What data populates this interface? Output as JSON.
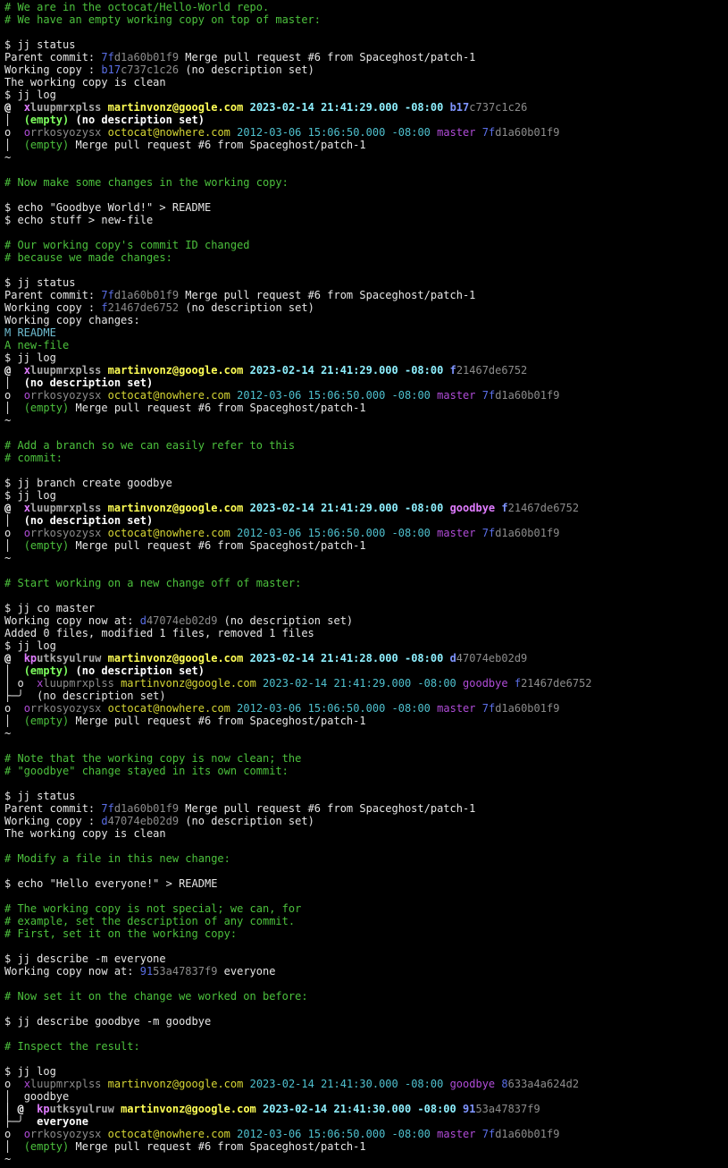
{
  "colors": {
    "background": "#000000",
    "text": "#e6e6e6",
    "comment": "#4cc13d",
    "change_id_prefix": "#b04cd8",
    "commit_id_prefix": "#5b6fe8",
    "email": "#d7d735",
    "timestamp": "#4fc1cf",
    "branch": "#b04cd8",
    "modified": "#6fbcd0",
    "added": "#4cc13d"
  },
  "lines": [
    [
      {
        "t": "# We are in the octocat/Hello-World repo.",
        "c": "comment"
      }
    ],
    [
      {
        "t": "# We have an empty working copy on top of master:",
        "c": "comment"
      }
    ],
    [],
    [
      {
        "t": "$ jj status",
        "c": "cmd"
      }
    ],
    [
      {
        "t": "Parent commit: ",
        "c": "plain"
      },
      {
        "t": "7f",
        "c": "c-blue"
      },
      {
        "t": "d1a60b01f9",
        "c": "c-gray"
      },
      {
        "t": " Merge pull request #6 from Spaceghost/patch-1",
        "c": "plain"
      }
    ],
    [
      {
        "t": "Working copy : ",
        "c": "plain"
      },
      {
        "t": "b17",
        "c": "c-blue"
      },
      {
        "t": "c737c1c26",
        "c": "c-gray"
      },
      {
        "t": " (no description set)",
        "c": "plain"
      }
    ],
    [
      {
        "t": "The working copy is clean",
        "c": "plain"
      }
    ],
    [
      {
        "t": "$ jj log",
        "c": "cmd"
      }
    ],
    [
      {
        "t": "@  ",
        "c": "c-bold"
      },
      {
        "t": "x",
        "c": "c-bpurple"
      },
      {
        "t": "luupmrxplss",
        "c": "c-bgray"
      },
      {
        "t": " ",
        "c": "plain"
      },
      {
        "t": "martinvonz@google.com",
        "c": "c-byellow"
      },
      {
        "t": " ",
        "c": "plain"
      },
      {
        "t": "2023-02-14 21:41:29.000 -08:00",
        "c": "c-bcyan"
      },
      {
        "t": " ",
        "c": "plain"
      },
      {
        "t": "b17",
        "c": "c-bblue"
      },
      {
        "t": "c737c1c26",
        "c": "c-gray"
      }
    ],
    [
      {
        "t": "│  ",
        "c": "c-white"
      },
      {
        "t": "(empty)",
        "c": "c-bgreen"
      },
      {
        "t": " (no description set)",
        "c": "c-bold"
      }
    ],
    [
      {
        "t": "o  ",
        "c": "c-white"
      },
      {
        "t": "o",
        "c": "c-purple"
      },
      {
        "t": "rrkosyozysx",
        "c": "c-gray"
      },
      {
        "t": " ",
        "c": "plain"
      },
      {
        "t": "octocat@nowhere.com",
        "c": "c-yellow"
      },
      {
        "t": " ",
        "c": "plain"
      },
      {
        "t": "2012-03-06 15:06:50.000 -08:00",
        "c": "c-cyan"
      },
      {
        "t": " ",
        "c": "plain"
      },
      {
        "t": "master",
        "c": "c-purple"
      },
      {
        "t": " ",
        "c": "plain"
      },
      {
        "t": "7f",
        "c": "c-blue"
      },
      {
        "t": "d1a60b01f9",
        "c": "c-gray"
      }
    ],
    [
      {
        "t": "│  ",
        "c": "c-white"
      },
      {
        "t": "(empty)",
        "c": "c-green"
      },
      {
        "t": " Merge pull request #6 from Spaceghost/patch-1",
        "c": "plain"
      }
    ],
    [
      {
        "t": "~",
        "c": "c-white"
      }
    ],
    [],
    [
      {
        "t": "# Now make some changes in the working copy:",
        "c": "comment"
      }
    ],
    [],
    [
      {
        "t": "$ echo \"Goodbye World!\" > README",
        "c": "cmd"
      }
    ],
    [
      {
        "t": "$ echo stuff > new-file",
        "c": "cmd"
      }
    ],
    [],
    [
      {
        "t": "# Our working copy's commit ID changed",
        "c": "comment"
      }
    ],
    [
      {
        "t": "# because we made changes:",
        "c": "comment"
      }
    ],
    [],
    [
      {
        "t": "$ jj status",
        "c": "cmd"
      }
    ],
    [
      {
        "t": "Parent commit: ",
        "c": "plain"
      },
      {
        "t": "7f",
        "c": "c-blue"
      },
      {
        "t": "d1a60b01f9",
        "c": "c-gray"
      },
      {
        "t": " Merge pull request #6 from Spaceghost/patch-1",
        "c": "plain"
      }
    ],
    [
      {
        "t": "Working copy : ",
        "c": "plain"
      },
      {
        "t": "f",
        "c": "c-blue"
      },
      {
        "t": "21467de6752",
        "c": "c-gray"
      },
      {
        "t": " (no description set)",
        "c": "plain"
      }
    ],
    [
      {
        "t": "Working copy changes:",
        "c": "plain"
      }
    ],
    [
      {
        "t": "M README",
        "c": "mod"
      }
    ],
    [
      {
        "t": "A new-file",
        "c": "add"
      }
    ],
    [
      {
        "t": "$ jj log",
        "c": "cmd"
      }
    ],
    [
      {
        "t": "@  ",
        "c": "c-bold"
      },
      {
        "t": "x",
        "c": "c-bpurple"
      },
      {
        "t": "luupmrxplss",
        "c": "c-bgray"
      },
      {
        "t": " ",
        "c": "plain"
      },
      {
        "t": "martinvonz@google.com",
        "c": "c-byellow"
      },
      {
        "t": " ",
        "c": "plain"
      },
      {
        "t": "2023-02-14 21:41:29.000 -08:00",
        "c": "c-bcyan"
      },
      {
        "t": " ",
        "c": "plain"
      },
      {
        "t": "f",
        "c": "c-bblue"
      },
      {
        "t": "21467de6752",
        "c": "c-gray"
      }
    ],
    [
      {
        "t": "│  ",
        "c": "c-white"
      },
      {
        "t": "(no description set)",
        "c": "c-bold"
      }
    ],
    [
      {
        "t": "o  ",
        "c": "c-white"
      },
      {
        "t": "o",
        "c": "c-purple"
      },
      {
        "t": "rrkosyozysx",
        "c": "c-gray"
      },
      {
        "t": " ",
        "c": "plain"
      },
      {
        "t": "octocat@nowhere.com",
        "c": "c-yellow"
      },
      {
        "t": " ",
        "c": "plain"
      },
      {
        "t": "2012-03-06 15:06:50.000 -08:00",
        "c": "c-cyan"
      },
      {
        "t": " ",
        "c": "plain"
      },
      {
        "t": "master",
        "c": "c-purple"
      },
      {
        "t": " ",
        "c": "plain"
      },
      {
        "t": "7f",
        "c": "c-blue"
      },
      {
        "t": "d1a60b01f9",
        "c": "c-gray"
      }
    ],
    [
      {
        "t": "│  ",
        "c": "c-white"
      },
      {
        "t": "(empty)",
        "c": "c-green"
      },
      {
        "t": " Merge pull request #6 from Spaceghost/patch-1",
        "c": "plain"
      }
    ],
    [
      {
        "t": "~",
        "c": "c-white"
      }
    ],
    [],
    [
      {
        "t": "# Add a branch so we can easily refer to this",
        "c": "comment"
      }
    ],
    [
      {
        "t": "# commit:",
        "c": "comment"
      }
    ],
    [],
    [
      {
        "t": "$ jj branch create goodbye",
        "c": "cmd"
      }
    ],
    [
      {
        "t": "$ jj log",
        "c": "cmd"
      }
    ],
    [
      {
        "t": "@  ",
        "c": "c-bold"
      },
      {
        "t": "x",
        "c": "c-bpurple"
      },
      {
        "t": "luupmrxplss",
        "c": "c-bgray"
      },
      {
        "t": " ",
        "c": "plain"
      },
      {
        "t": "martinvonz@google.com",
        "c": "c-byellow"
      },
      {
        "t": " ",
        "c": "plain"
      },
      {
        "t": "2023-02-14 21:41:29.000 -08:00",
        "c": "c-bcyan"
      },
      {
        "t": " ",
        "c": "plain"
      },
      {
        "t": "goodbye",
        "c": "c-bpurple"
      },
      {
        "t": " ",
        "c": "plain"
      },
      {
        "t": "f",
        "c": "c-bblue"
      },
      {
        "t": "21467de6752",
        "c": "c-gray"
      }
    ],
    [
      {
        "t": "│  ",
        "c": "c-white"
      },
      {
        "t": "(no description set)",
        "c": "c-bold"
      }
    ],
    [
      {
        "t": "o  ",
        "c": "c-white"
      },
      {
        "t": "o",
        "c": "c-purple"
      },
      {
        "t": "rrkosyozysx",
        "c": "c-gray"
      },
      {
        "t": " ",
        "c": "plain"
      },
      {
        "t": "octocat@nowhere.com",
        "c": "c-yellow"
      },
      {
        "t": " ",
        "c": "plain"
      },
      {
        "t": "2012-03-06 15:06:50.000 -08:00",
        "c": "c-cyan"
      },
      {
        "t": " ",
        "c": "plain"
      },
      {
        "t": "master",
        "c": "c-purple"
      },
      {
        "t": " ",
        "c": "plain"
      },
      {
        "t": "7f",
        "c": "c-blue"
      },
      {
        "t": "d1a60b01f9",
        "c": "c-gray"
      }
    ],
    [
      {
        "t": "│  ",
        "c": "c-white"
      },
      {
        "t": "(empty)",
        "c": "c-green"
      },
      {
        "t": " Merge pull request #6 from Spaceghost/patch-1",
        "c": "plain"
      }
    ],
    [
      {
        "t": "~",
        "c": "c-white"
      }
    ],
    [],
    [
      {
        "t": "# Start working on a new change off of master:",
        "c": "comment"
      }
    ],
    [],
    [
      {
        "t": "$ jj co master",
        "c": "cmd"
      }
    ],
    [
      {
        "t": "Working copy now at: ",
        "c": "plain"
      },
      {
        "t": "d",
        "c": "c-blue"
      },
      {
        "t": "47074eb02d9",
        "c": "c-gray"
      },
      {
        "t": " (no description set)",
        "c": "plain"
      }
    ],
    [
      {
        "t": "Added 0 files, modified 1 files, removed 1 files",
        "c": "plain"
      }
    ],
    [
      {
        "t": "$ jj log",
        "c": "cmd"
      }
    ],
    [
      {
        "t": "@  ",
        "c": "c-bold"
      },
      {
        "t": "kp",
        "c": "c-bpurple"
      },
      {
        "t": "utksyulruw",
        "c": "c-bgray"
      },
      {
        "t": " ",
        "c": "plain"
      },
      {
        "t": "martinvonz@google.com",
        "c": "c-byellow"
      },
      {
        "t": " ",
        "c": "plain"
      },
      {
        "t": "2023-02-14 21:41:28.000 -08:00",
        "c": "c-bcyan"
      },
      {
        "t": " ",
        "c": "plain"
      },
      {
        "t": "d",
        "c": "c-bblue"
      },
      {
        "t": "47074eb02d9",
        "c": "c-gray"
      }
    ],
    [
      {
        "t": "│  ",
        "c": "c-white"
      },
      {
        "t": "(empty)",
        "c": "c-bgreen"
      },
      {
        "t": " (no description set)",
        "c": "c-bold"
      }
    ],
    [
      {
        "t": "│ o  ",
        "c": "c-white"
      },
      {
        "t": "x",
        "c": "c-purple"
      },
      {
        "t": "luupmrxplss",
        "c": "c-gray"
      },
      {
        "t": " ",
        "c": "plain"
      },
      {
        "t": "martinvonz@google.com",
        "c": "c-yellow"
      },
      {
        "t": " ",
        "c": "plain"
      },
      {
        "t": "2023-02-14 21:41:29.000 -08:00",
        "c": "c-cyan"
      },
      {
        "t": " ",
        "c": "plain"
      },
      {
        "t": "goodbye",
        "c": "c-purple"
      },
      {
        "t": " ",
        "c": "plain"
      },
      {
        "t": "f",
        "c": "c-blue"
      },
      {
        "t": "21467de6752",
        "c": "c-gray"
      }
    ],
    [
      {
        "t": "├─╯  ",
        "c": "c-white"
      },
      {
        "t": "(no description set)",
        "c": "plain"
      }
    ],
    [
      {
        "t": "o  ",
        "c": "c-white"
      },
      {
        "t": "o",
        "c": "c-purple"
      },
      {
        "t": "rrkosyozysx",
        "c": "c-gray"
      },
      {
        "t": " ",
        "c": "plain"
      },
      {
        "t": "octocat@nowhere.com",
        "c": "c-yellow"
      },
      {
        "t": " ",
        "c": "plain"
      },
      {
        "t": "2012-03-06 15:06:50.000 -08:00",
        "c": "c-cyan"
      },
      {
        "t": " ",
        "c": "plain"
      },
      {
        "t": "master",
        "c": "c-purple"
      },
      {
        "t": " ",
        "c": "plain"
      },
      {
        "t": "7f",
        "c": "c-blue"
      },
      {
        "t": "d1a60b01f9",
        "c": "c-gray"
      }
    ],
    [
      {
        "t": "│  ",
        "c": "c-white"
      },
      {
        "t": "(empty)",
        "c": "c-green"
      },
      {
        "t": " Merge pull request #6 from Spaceghost/patch-1",
        "c": "plain"
      }
    ],
    [
      {
        "t": "~",
        "c": "c-white"
      }
    ],
    [],
    [
      {
        "t": "# Note that the working copy is now clean; the",
        "c": "comment"
      }
    ],
    [
      {
        "t": "# \"goodbye\" change stayed in its own commit:",
        "c": "comment"
      }
    ],
    [],
    [
      {
        "t": "$ jj status",
        "c": "cmd"
      }
    ],
    [
      {
        "t": "Parent commit: ",
        "c": "plain"
      },
      {
        "t": "7f",
        "c": "c-blue"
      },
      {
        "t": "d1a60b01f9",
        "c": "c-gray"
      },
      {
        "t": " Merge pull request #6 from Spaceghost/patch-1",
        "c": "plain"
      }
    ],
    [
      {
        "t": "Working copy : ",
        "c": "plain"
      },
      {
        "t": "d",
        "c": "c-blue"
      },
      {
        "t": "47074eb02d9",
        "c": "c-gray"
      },
      {
        "t": " (no description set)",
        "c": "plain"
      }
    ],
    [
      {
        "t": "The working copy is clean",
        "c": "plain"
      }
    ],
    [],
    [
      {
        "t": "# Modify a file in this new change:",
        "c": "comment"
      }
    ],
    [],
    [
      {
        "t": "$ echo \"Hello everyone!\" > README",
        "c": "cmd"
      }
    ],
    [],
    [
      {
        "t": "# The working copy is not special; we can, for",
        "c": "comment"
      }
    ],
    [
      {
        "t": "# example, set the description of any commit.",
        "c": "comment"
      }
    ],
    [
      {
        "t": "# First, set it on the working copy:",
        "c": "comment"
      }
    ],
    [],
    [
      {
        "t": "$ jj describe -m everyone",
        "c": "cmd"
      }
    ],
    [
      {
        "t": "Working copy now at: ",
        "c": "plain"
      },
      {
        "t": "91",
        "c": "c-blue"
      },
      {
        "t": "53a47837f9",
        "c": "c-gray"
      },
      {
        "t": " everyone",
        "c": "plain"
      }
    ],
    [],
    [
      {
        "t": "# Now set it on the change we worked on before:",
        "c": "comment"
      }
    ],
    [],
    [
      {
        "t": "$ jj describe goodbye -m goodbye",
        "c": "cmd"
      }
    ],
    [],
    [
      {
        "t": "# Inspect the result:",
        "c": "comment"
      }
    ],
    [],
    [
      {
        "t": "$ jj log",
        "c": "cmd"
      }
    ],
    [
      {
        "t": "o  ",
        "c": "c-white"
      },
      {
        "t": "x",
        "c": "c-purple"
      },
      {
        "t": "luupmrxplss",
        "c": "c-gray"
      },
      {
        "t": " ",
        "c": "plain"
      },
      {
        "t": "martinvonz@google.com",
        "c": "c-yellow"
      },
      {
        "t": " ",
        "c": "plain"
      },
      {
        "t": "2023-02-14 21:41:30.000 -08:00",
        "c": "c-cyan"
      },
      {
        "t": " ",
        "c": "plain"
      },
      {
        "t": "goodbye",
        "c": "c-purple"
      },
      {
        "t": " ",
        "c": "plain"
      },
      {
        "t": "8",
        "c": "c-blue"
      },
      {
        "t": "633a4a624d2",
        "c": "c-gray"
      }
    ],
    [
      {
        "t": "│  ",
        "c": "c-white"
      },
      {
        "t": "goodbye",
        "c": "plain"
      }
    ],
    [
      {
        "t": "│ @  ",
        "c": "c-bold"
      },
      {
        "t": "kp",
        "c": "c-bpurple"
      },
      {
        "t": "utksyulruw",
        "c": "c-bgray"
      },
      {
        "t": " ",
        "c": "plain"
      },
      {
        "t": "martinvonz@google.com",
        "c": "c-byellow"
      },
      {
        "t": " ",
        "c": "plain"
      },
      {
        "t": "2023-02-14 21:41:30.000 -08:00",
        "c": "c-bcyan"
      },
      {
        "t": " ",
        "c": "plain"
      },
      {
        "t": "91",
        "c": "c-bblue"
      },
      {
        "t": "53a47837f9",
        "c": "c-gray"
      }
    ],
    [
      {
        "t": "├─╯  ",
        "c": "c-white"
      },
      {
        "t": "everyone",
        "c": "c-bold"
      }
    ],
    [
      {
        "t": "o  ",
        "c": "c-white"
      },
      {
        "t": "o",
        "c": "c-purple"
      },
      {
        "t": "rrkosyozysx",
        "c": "c-gray"
      },
      {
        "t": " ",
        "c": "plain"
      },
      {
        "t": "octocat@nowhere.com",
        "c": "c-yellow"
      },
      {
        "t": " ",
        "c": "plain"
      },
      {
        "t": "2012-03-06 15:06:50.000 -08:00",
        "c": "c-cyan"
      },
      {
        "t": " ",
        "c": "plain"
      },
      {
        "t": "master",
        "c": "c-purple"
      },
      {
        "t": " ",
        "c": "plain"
      },
      {
        "t": "7f",
        "c": "c-blue"
      },
      {
        "t": "d1a60b01f9",
        "c": "c-gray"
      }
    ],
    [
      {
        "t": "│  ",
        "c": "c-white"
      },
      {
        "t": "(empty)",
        "c": "c-green"
      },
      {
        "t": " Merge pull request #6 from Spaceghost/patch-1",
        "c": "plain"
      }
    ],
    [
      {
        "t": "~",
        "c": "c-white"
      }
    ]
  ]
}
